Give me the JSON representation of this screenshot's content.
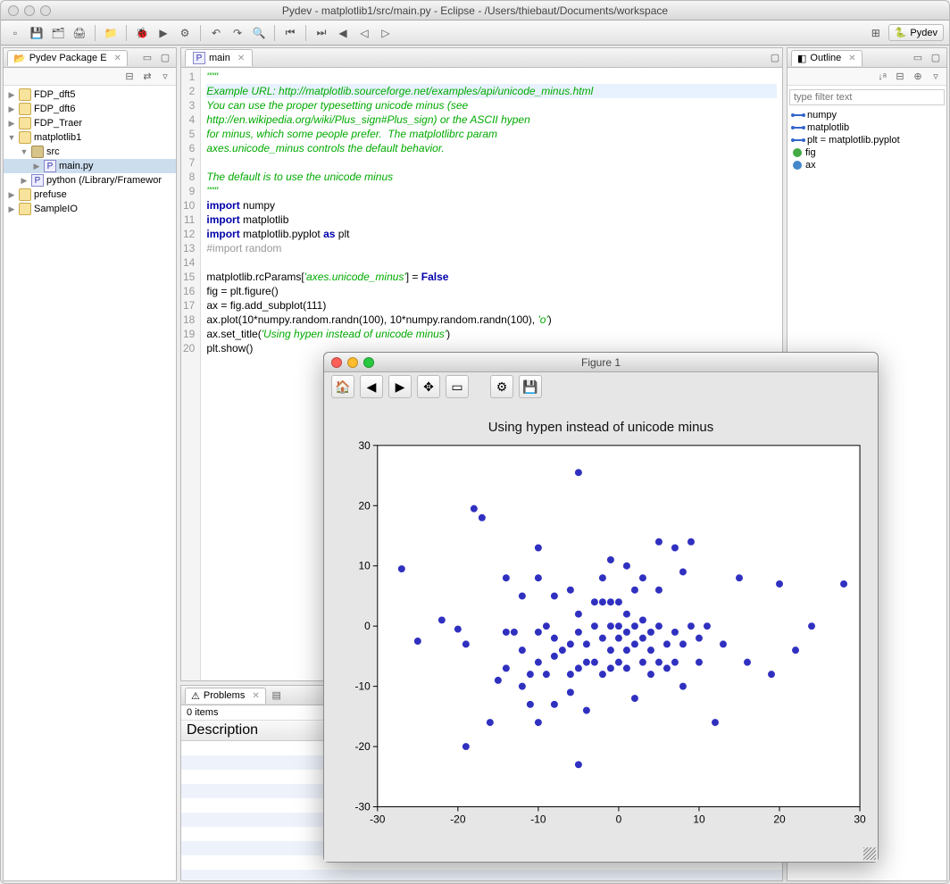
{
  "window_title": "Pydev - matplotlib1/src/main.py - Eclipse - /Users/thiebaut/Documents/workspace",
  "perspective": {
    "label": "Pydev"
  },
  "toolbar_icons": [
    "new",
    "save",
    "saveall",
    "print",
    "open",
    "debug",
    "run",
    "ext",
    "back",
    "fwd",
    "search",
    "last",
    "next",
    "prev",
    "prev2",
    "next2"
  ],
  "package_explorer": {
    "tab": "Pydev Package E",
    "items": [
      {
        "label": "FDP_dft5",
        "icon": "folder",
        "depth": 0,
        "chev": "▶"
      },
      {
        "label": "FDP_dft6",
        "icon": "folder",
        "depth": 0,
        "chev": "▶"
      },
      {
        "label": "FDP_Traer",
        "icon": "folder",
        "depth": 0,
        "chev": "▶"
      },
      {
        "label": "matplotlib1",
        "icon": "folder",
        "depth": 0,
        "chev": "▼"
      },
      {
        "label": "src",
        "icon": "pkg",
        "depth": 1,
        "chev": "▼"
      },
      {
        "label": "main.py",
        "icon": "py",
        "depth": 2,
        "chev": "▶",
        "sel": true
      },
      {
        "label": "python  (/Library/Framewor",
        "icon": "py",
        "depth": 1,
        "chev": "▶"
      },
      {
        "label": "prefuse",
        "icon": "folder",
        "depth": 0,
        "chev": "▶"
      },
      {
        "label": "SampleIO",
        "icon": "folder",
        "depth": 0,
        "chev": "▶"
      }
    ]
  },
  "editor": {
    "tab": "main",
    "lines": [
      {
        "n": 1,
        "cls": "tok-str",
        "text": "\"\"\""
      },
      {
        "n": 2,
        "cls": "tok-str hl",
        "text": "Example URL: http://matplotlib.sourceforge.net/examples/api/unicode_minus.html"
      },
      {
        "n": 3,
        "cls": "tok-str",
        "text": "You can use the proper typesetting unicode minus (see"
      },
      {
        "n": 4,
        "cls": "tok-str",
        "text": "http://en.wikipedia.org/wiki/Plus_sign#Plus_sign) or the ASCII hypen"
      },
      {
        "n": 5,
        "cls": "tok-str",
        "text": "for minus, which some people prefer.  The matplotlibrc param"
      },
      {
        "n": 6,
        "cls": "tok-str",
        "text": "axes.unicode_minus controls the default behavior."
      },
      {
        "n": 7,
        "cls": "tok-str",
        "text": ""
      },
      {
        "n": 8,
        "cls": "tok-str",
        "text": "The default is to use the unicode minus"
      },
      {
        "n": 9,
        "cls": "tok-str",
        "text": "\"\"\""
      },
      {
        "n": 10,
        "cls": "",
        "text": "import numpy"
      },
      {
        "n": 11,
        "cls": "",
        "text": "import matplotlib"
      },
      {
        "n": 12,
        "cls": "",
        "text": "import matplotlib.pyplot as plt"
      },
      {
        "n": 13,
        "cls": "tok-cmt",
        "text": "#import random"
      },
      {
        "n": 14,
        "cls": "",
        "text": ""
      },
      {
        "n": 15,
        "cls": "",
        "text": "matplotlib.rcParams['axes.unicode_minus'] = False"
      },
      {
        "n": 16,
        "cls": "",
        "text": "fig = plt.figure()"
      },
      {
        "n": 17,
        "cls": "",
        "text": "ax = fig.add_subplot(111)"
      },
      {
        "n": 18,
        "cls": "",
        "text": "ax.plot(10*numpy.random.randn(100), 10*numpy.random.randn(100), 'o')"
      },
      {
        "n": 19,
        "cls": "",
        "text": "ax.set_title('Using hypen instead of unicode minus')"
      },
      {
        "n": 20,
        "cls": "",
        "text": "plt.show()"
      }
    ]
  },
  "outline": {
    "tab": "Outline",
    "filter_placeholder": "type filter text",
    "items": [
      {
        "label": "numpy",
        "kind": "import"
      },
      {
        "label": "matplotlib",
        "kind": "import"
      },
      {
        "label": "plt = matplotlib.pyplot",
        "kind": "import"
      },
      {
        "label": "fig",
        "kind": "var"
      },
      {
        "label": "ax",
        "kind": "varb"
      }
    ]
  },
  "problems": {
    "tab": "Problems",
    "count": "0 items",
    "column": "Description"
  },
  "figure": {
    "title": "Figure 1",
    "toolbar": [
      "home",
      "back",
      "forward",
      "pan",
      "zoom",
      "config",
      "save"
    ]
  },
  "chart_data": {
    "type": "scatter",
    "title": "Using hypen instead of unicode minus",
    "xlabel": "",
    "ylabel": "",
    "xlim": [
      -30,
      30
    ],
    "ylim": [
      -30,
      30
    ],
    "xticks": [
      -30,
      -20,
      -10,
      0,
      10,
      20,
      30
    ],
    "yticks": [
      -30,
      -20,
      -10,
      0,
      10,
      20,
      30
    ],
    "series": [
      {
        "name": "",
        "points": [
          [
            -27,
            9.5
          ],
          [
            -25,
            -2.5
          ],
          [
            -22,
            1
          ],
          [
            -20,
            -0.5
          ],
          [
            -19,
            -3
          ],
          [
            -19,
            -20
          ],
          [
            -18,
            19.5
          ],
          [
            -17,
            18
          ],
          [
            -16,
            -16
          ],
          [
            -15,
            -9
          ],
          [
            -14,
            8
          ],
          [
            -14,
            -1
          ],
          [
            -14,
            -7
          ],
          [
            -13,
            -1
          ],
          [
            -12,
            5
          ],
          [
            -12,
            -4
          ],
          [
            -12,
            -10
          ],
          [
            -11,
            -8
          ],
          [
            -11,
            -13
          ],
          [
            -10,
            13
          ],
          [
            -10,
            8
          ],
          [
            -10,
            -1
          ],
          [
            -10,
            -6
          ],
          [
            -10,
            -16
          ],
          [
            -9,
            0
          ],
          [
            -9,
            -8
          ],
          [
            -8,
            5
          ],
          [
            -8,
            -2
          ],
          [
            -8,
            -5
          ],
          [
            -8,
            -13
          ],
          [
            -7,
            -4
          ],
          [
            -6,
            6
          ],
          [
            -6,
            -3
          ],
          [
            -6,
            -8
          ],
          [
            -6,
            -11
          ],
          [
            -5,
            25.5
          ],
          [
            -5,
            2
          ],
          [
            -5,
            -1
          ],
          [
            -5,
            -7
          ],
          [
            -5,
            -23
          ],
          [
            -4,
            -3
          ],
          [
            -4,
            -6
          ],
          [
            -4,
            -14
          ],
          [
            -3,
            4
          ],
          [
            -3,
            0
          ],
          [
            -3,
            -6
          ],
          [
            -2,
            8
          ],
          [
            -2,
            4
          ],
          [
            -2,
            -2
          ],
          [
            -2,
            -8
          ],
          [
            -1,
            11
          ],
          [
            -1,
            4
          ],
          [
            -1,
            0
          ],
          [
            -1,
            -4
          ],
          [
            -1,
            -7
          ],
          [
            0,
            4
          ],
          [
            0,
            0
          ],
          [
            0,
            -2
          ],
          [
            0,
            -6
          ],
          [
            1,
            10
          ],
          [
            1,
            2
          ],
          [
            1,
            -1
          ],
          [
            1,
            -4
          ],
          [
            1,
            -7
          ],
          [
            2,
            6
          ],
          [
            2,
            0
          ],
          [
            2,
            -3
          ],
          [
            2,
            -12
          ],
          [
            3,
            8
          ],
          [
            3,
            1
          ],
          [
            3,
            -2
          ],
          [
            3,
            -6
          ],
          [
            4,
            -1
          ],
          [
            4,
            -4
          ],
          [
            4,
            -8
          ],
          [
            5,
            14
          ],
          [
            5,
            6
          ],
          [
            5,
            0
          ],
          [
            5,
            -6
          ],
          [
            6,
            -3
          ],
          [
            6,
            -7
          ],
          [
            7,
            13
          ],
          [
            7,
            -1
          ],
          [
            7,
            -6
          ],
          [
            8,
            9
          ],
          [
            8,
            -3
          ],
          [
            8,
            -10
          ],
          [
            9,
            0
          ],
          [
            9,
            14
          ],
          [
            10,
            -2
          ],
          [
            10,
            -6
          ],
          [
            11,
            0
          ],
          [
            12,
            -16
          ],
          [
            13,
            -3
          ],
          [
            15,
            8
          ],
          [
            16,
            -6
          ],
          [
            19,
            -8
          ],
          [
            20,
            7
          ],
          [
            22,
            -4
          ],
          [
            24,
            0
          ],
          [
            28,
            7
          ]
        ]
      }
    ]
  }
}
